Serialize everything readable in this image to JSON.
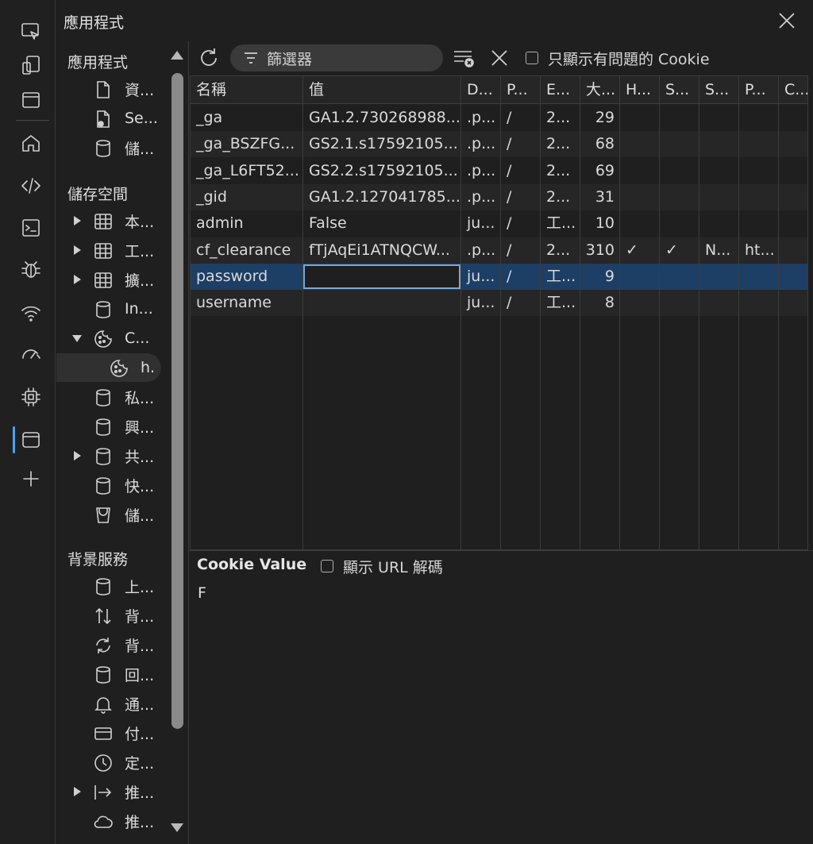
{
  "app_title": "應用程式",
  "activity": [
    "inspect-icon",
    "device-icon",
    "dock-icon",
    "home-icon",
    "elements-icon",
    "console-icon",
    "sources-icon",
    "network-icon",
    "performance-icon",
    "memory-icon",
    "application-icon",
    "add-icon"
  ],
  "sidebar": {
    "sections": {
      "app": "應用程式",
      "storage": "儲存空間",
      "background": "背景服務"
    },
    "app_items": [
      {
        "label": "資...",
        "icon": "file-icon"
      },
      {
        "label": "Se...",
        "icon": "service-worker-icon"
      },
      {
        "label": "儲...",
        "icon": "database-icon"
      }
    ],
    "storage_items": [
      {
        "label": "本...",
        "icon": "table-icon",
        "arrow": "right"
      },
      {
        "label": "工...",
        "icon": "table-icon",
        "arrow": "right"
      },
      {
        "label": "擴...",
        "icon": "table-icon",
        "arrow": "right"
      },
      {
        "label": "In...",
        "icon": "database-icon",
        "arrow": ""
      },
      {
        "label": "C...",
        "icon": "cookie-icon",
        "arrow": "down"
      },
      {
        "label": "h...",
        "icon": "cookie-icon",
        "arrow": "",
        "child": true,
        "selected": true
      },
      {
        "label": "私...",
        "icon": "database-icon",
        "arrow": ""
      },
      {
        "label": "興...",
        "icon": "database-icon",
        "arrow": ""
      },
      {
        "label": "共...",
        "icon": "database-icon",
        "arrow": "right"
      },
      {
        "label": "快...",
        "icon": "database-icon",
        "arrow": ""
      },
      {
        "label": "儲...",
        "icon": "bucket-icon",
        "arrow": ""
      }
    ],
    "background_items": [
      {
        "label": "上...",
        "icon": "database-icon",
        "arrow": ""
      },
      {
        "label": "背...",
        "icon": "arrows-updown-icon",
        "arrow": ""
      },
      {
        "label": "背...",
        "icon": "sync-icon",
        "arrow": ""
      },
      {
        "label": "回...",
        "icon": "database-icon",
        "arrow": ""
      },
      {
        "label": "通...",
        "icon": "bell-icon",
        "arrow": ""
      },
      {
        "label": "付...",
        "icon": "card-icon",
        "arrow": ""
      },
      {
        "label": "定...",
        "icon": "clock-icon",
        "arrow": ""
      },
      {
        "label": "推...",
        "icon": "push-arrow-icon",
        "arrow": "right"
      },
      {
        "label": "推...",
        "icon": "cloud-icon",
        "arrow": ""
      }
    ]
  },
  "toolbar": {
    "filter_placeholder": "篩選器",
    "only_issues_label": "只顯示有問題的 Cookie"
  },
  "table": {
    "columns": [
      "名稱",
      "值",
      "D...",
      "P...",
      "E...",
      "大...",
      "H...",
      "S...",
      "S...",
      "P...",
      "C..."
    ],
    "rows": [
      [
        "_ga",
        "GA1.2.730268988....",
        ".p...",
        "/",
        "2...",
        "29",
        "",
        "",
        "",
        "",
        ""
      ],
      [
        "_ga_BSZFG...",
        "GS2.1.s17592105...",
        ".p...",
        "/",
        "2...",
        "68",
        "",
        "",
        "",
        "",
        ""
      ],
      [
        "_ga_L6FT52...",
        "GS2.2.s17592105...",
        ".p...",
        "/",
        "2...",
        "69",
        "",
        "",
        "",
        "",
        ""
      ],
      [
        "_gid",
        "GA1.2.127041785....",
        ".p...",
        "/",
        "2...",
        "31",
        "",
        "",
        "",
        "",
        ""
      ],
      [
        "admin",
        "False",
        "ju...",
        "/",
        "工...",
        "10",
        "",
        "",
        "",
        "",
        ""
      ],
      [
        "cf_clearance",
        "fTjAqEi1ATNQCW...",
        ".p...",
        "/",
        "2...",
        "310",
        "✓",
        "✓",
        "N...",
        "ht...",
        ""
      ],
      [
        "password",
        "",
        "ju...",
        "/",
        "工...",
        "9",
        "",
        "",
        "",
        "",
        ""
      ],
      [
        "username",
        "",
        "ju...",
        "/",
        "工...",
        "8",
        "",
        "",
        "",
        "",
        ""
      ]
    ],
    "selected_row": 6
  },
  "cookie_value": {
    "title": "Cookie Value",
    "decode_label": "顯示 URL 解碼",
    "value": "F"
  }
}
